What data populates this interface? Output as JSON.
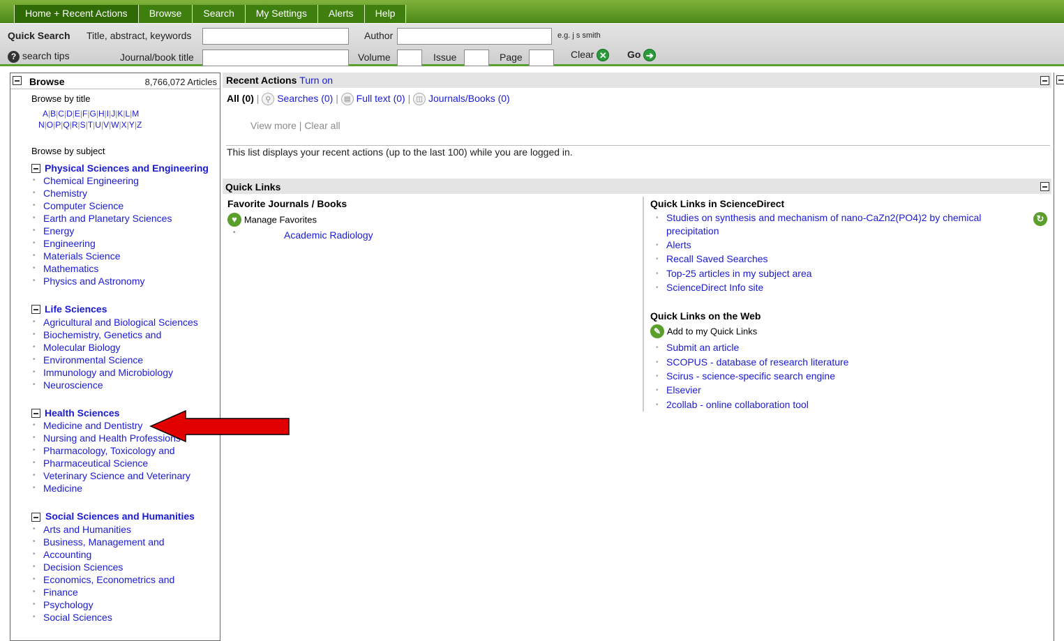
{
  "nav": {
    "tabs": [
      "Home + Recent Actions",
      "Browse",
      "Search",
      "My Settings",
      "Alerts",
      "Help"
    ]
  },
  "search": {
    "quick_search": "Quick Search",
    "title_label": "Title, abstract, keywords",
    "author_label": "Author",
    "author_hint": "e.g. j s smith",
    "search_tips": "search tips",
    "journal_label": "Journal/book title",
    "volume_label": "Volume",
    "issue_label": "Issue",
    "page_label": "Page",
    "clear": "Clear",
    "go": "Go"
  },
  "browse": {
    "title": "Browse",
    "count": "8,766,072 Articles",
    "by_title": "Browse by title",
    "letters_row1": [
      "A",
      "B",
      "C",
      "D",
      "E",
      "F",
      "G",
      "H",
      "I",
      "J",
      "K",
      "L",
      "M"
    ],
    "letters_row2": [
      "N",
      "O",
      "P",
      "Q",
      "R",
      "S",
      "T",
      "U",
      "V",
      "W",
      "X",
      "Y",
      "Z"
    ],
    "by_subject": "Browse by subject",
    "sections": [
      {
        "title": "Physical Sciences and Engineering",
        "items": [
          "Chemical Engineering",
          "Chemistry",
          "Computer Science",
          "Earth and Planetary Sciences",
          "Energy",
          "Engineering",
          "Materials Science",
          "Mathematics",
          "Physics and Astronomy"
        ]
      },
      {
        "title": "Life Sciences",
        "items": [
          "Agricultural and Biological Sciences",
          "Biochemistry, Genetics and",
          "Molecular Biology",
          "Environmental Science",
          "Immunology and Microbiology",
          "Neuroscience"
        ]
      },
      {
        "title": "Health Sciences",
        "items": [
          "Medicine and Dentistry",
          "Nursing and Health Professions",
          "Pharmacology, Toxicology and",
          "Pharmaceutical Science",
          "Veterinary Science and Veterinary",
          "Medicine"
        ]
      },
      {
        "title": "Social Sciences and Humanities",
        "items": [
          "Arts and Humanities",
          "Business, Management and",
          "Accounting",
          "Decision Sciences",
          "Economics, Econometrics and",
          "Finance",
          "Psychology",
          "Social Sciences"
        ]
      }
    ]
  },
  "recent": {
    "title": "Recent Actions",
    "turn_on": "Turn on",
    "all": "All (0)",
    "sep": "|",
    "searches": "Searches (0)",
    "fulltext": "Full text (0)",
    "journals": "Journals/Books (0)",
    "view_more": "View more",
    "clear_all": "Clear all",
    "note": "This list displays your recent actions (up to the last 100) while you are logged in."
  },
  "quicklinks": {
    "title": "Quick Links",
    "fav_title": "Favorite Journals / Books",
    "manage_fav": "Manage Favorites",
    "fav_items": [
      "Academic Radiology"
    ],
    "sd_title": "Quick Links in ScienceDirect",
    "sd_item1_line1": "Studies on synthesis and mechanism of nano-CaZn2(PO4)2 by chemical",
    "sd_item1_line2": "precipitation",
    "sd_items": [
      "Alerts",
      "Recall Saved Searches",
      "Top-25 articles in my subject area",
      "ScienceDirect Info site"
    ],
    "web_title": "Quick Links on the Web",
    "add_quick": "Add to my Quick Links",
    "web_items": [
      "Submit an article",
      "SCOPUS - database of research literature",
      "Scirus - science-specific search engine",
      "Elsevier",
      "2collab - online collaboration tool"
    ]
  },
  "colors": {
    "nav_green": "#4c8a18",
    "link": "#1a1ad6",
    "visited": "#8b0a8b",
    "arrow": "#e00000"
  }
}
